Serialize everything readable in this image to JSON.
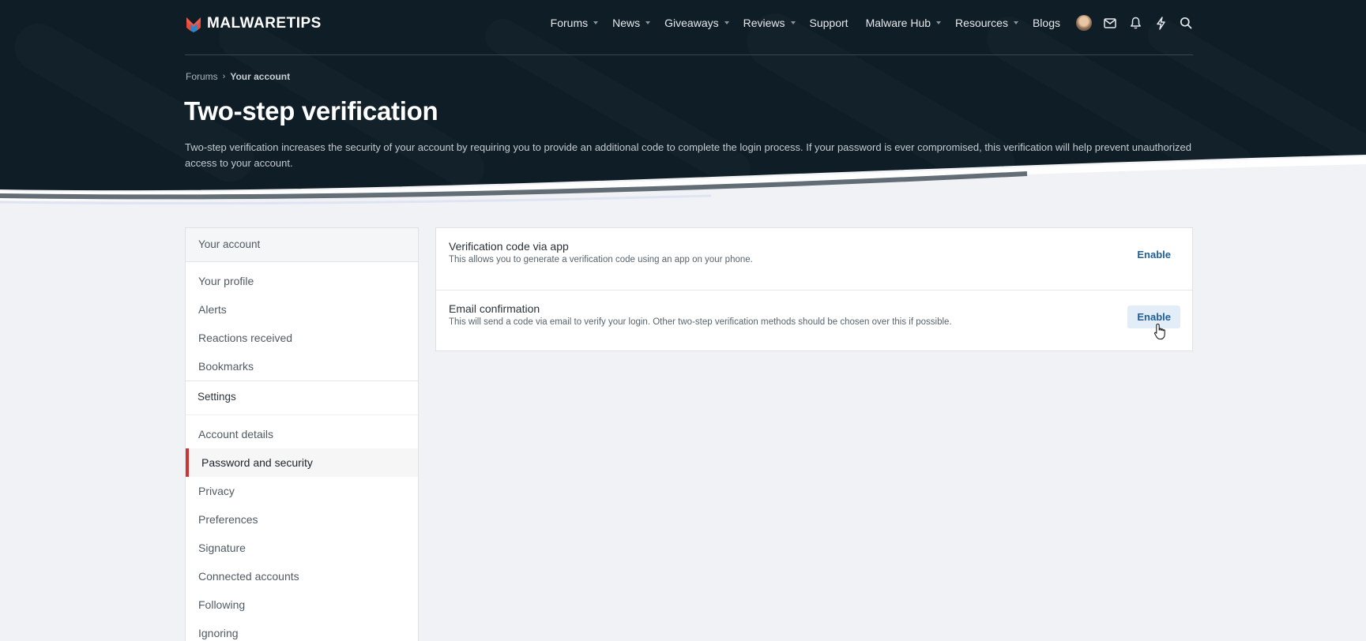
{
  "brand": {
    "name": "MALWARETIPS"
  },
  "nav": {
    "items": [
      {
        "label": "Forums",
        "dropdown": true
      },
      {
        "label": "News",
        "dropdown": true
      },
      {
        "label": "Giveaways",
        "dropdown": true
      },
      {
        "label": "Reviews",
        "dropdown": true
      },
      {
        "label": "Support",
        "dropdown": false
      },
      {
        "label": "Malware Hub",
        "dropdown": true
      },
      {
        "label": "Resources",
        "dropdown": true
      },
      {
        "label": "Blogs",
        "dropdown": false
      }
    ],
    "icons": [
      "avatar",
      "envelope-icon",
      "bell-icon",
      "lightning-icon",
      "search-icon"
    ]
  },
  "breadcrumb": {
    "root": "Forums",
    "current": "Your account"
  },
  "page": {
    "title": "Two-step verification",
    "description": "Two-step verification increases the security of your account by requiring you to provide an additional code to complete the login process. If your password is ever compromised, this verification will help prevent unauthorized access to your account."
  },
  "sidebar": {
    "account_header": "Your account",
    "account_items": [
      "Your profile",
      "Alerts",
      "Reactions received",
      "Bookmarks"
    ],
    "settings_header": "Settings",
    "settings_items": [
      "Account details",
      "Password and security",
      "Privacy",
      "Preferences",
      "Signature",
      "Connected accounts",
      "Following",
      "Ignoring"
    ],
    "active": "Password and security"
  },
  "methods": [
    {
      "title": "Verification code via app",
      "description": "This allows you to generate a verification code using an app on your phone.",
      "button": "Enable"
    },
    {
      "title": "Email confirmation",
      "description": "This will send a code via email to verify your login. Other two-step verification methods should be chosen over this if possible.",
      "button": "Enable"
    }
  ],
  "colors": {
    "header_bg": "#0f1d26",
    "accent_link": "#1f5e96",
    "active_marker": "#cf3434",
    "page_bg": "#f1f2f6"
  }
}
